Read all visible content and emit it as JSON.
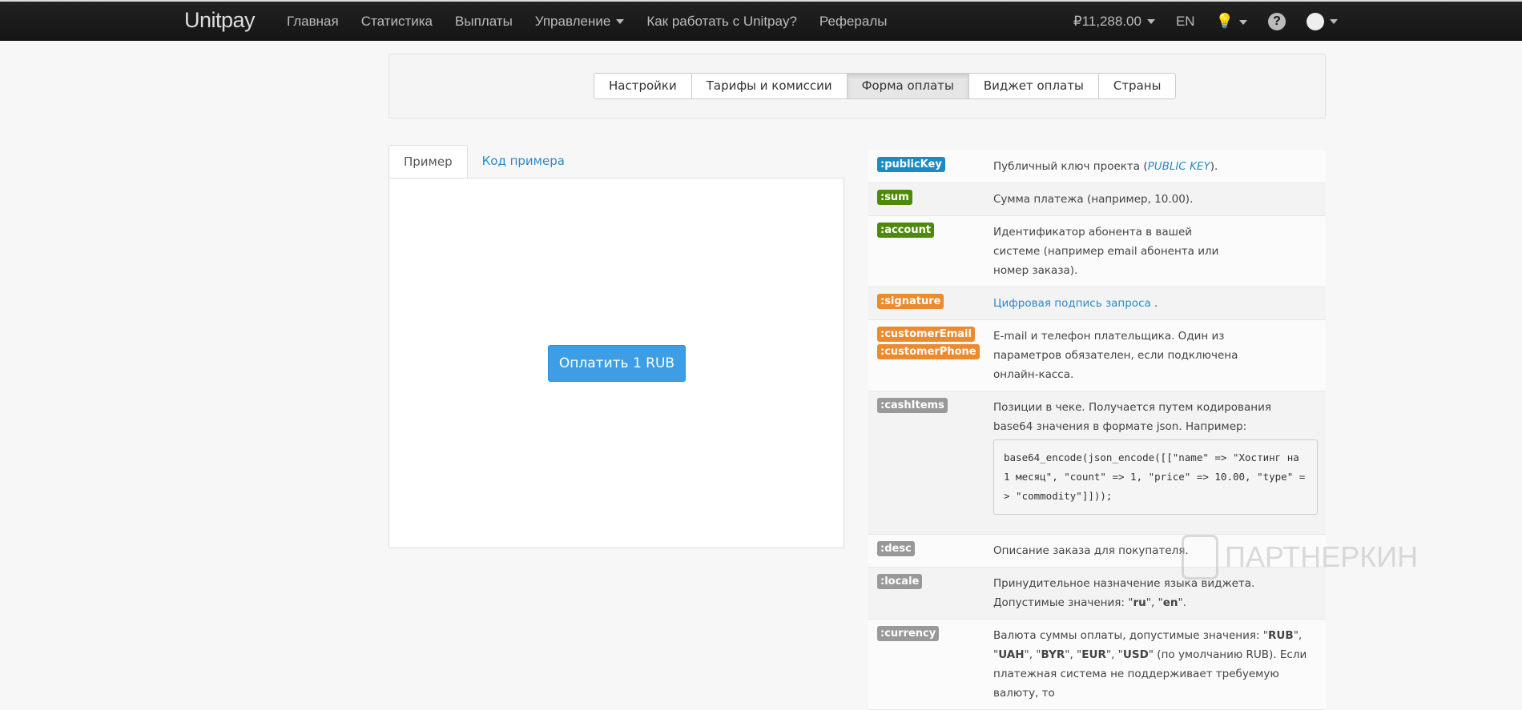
{
  "nav": {
    "logo": "Unitpay",
    "items": [
      "Главная",
      "Статистика",
      "Выплаты",
      "Управление",
      "Как работать с Unitpay?",
      "Рефералы"
    ],
    "balance": "₽11,288.00",
    "lang": "EN"
  },
  "settings_tabs": [
    {
      "label": "Настройки"
    },
    {
      "label": "Тарифы и комиссии"
    },
    {
      "label": "Форма оплаты",
      "active": true
    },
    {
      "label": "Виджет оплаты"
    },
    {
      "label": "Страны"
    }
  ],
  "example": {
    "tabs": [
      "Пример",
      "Код примера"
    ],
    "pay_button": "Оплатить 1 RUB"
  },
  "params": [
    {
      "name": ":publicKey",
      "color": "blue",
      "d1": "Публичный ключ проекта (",
      "link": "PUBLIC KEY",
      "d2": ")."
    },
    {
      "name": ":sum",
      "color": "green",
      "desc": "Сумма платежа (например, 10.00)."
    },
    {
      "name": ":account",
      "color": "green",
      "desc": "Идентификатор абонента в вашей системе (например email абонента или номер заказа)."
    },
    {
      "name": ":signature",
      "color": "orange",
      "link": "Цифровая подпись запроса",
      "d2": " ."
    },
    {
      "name": ":customerEmail",
      "name2": ":customerPhone",
      "color": "orange",
      "desc": "E-mail и телефон плательщика. Один из параметров обязателен, если подключена онлайн-касса."
    },
    {
      "name": ":cashItems",
      "color": "gray",
      "desc": "Позиции в чеке. Получается путем кодирования base64 значения в формате json. Например:",
      "code": "base64_encode(json_encode([[\"name\" => \"Хостинг на 1 месяц\", \"count\" => 1, \"price\" => 10.00, \"type\" => \"commodity\"]]));"
    },
    {
      "name": ":desc",
      "color": "gray",
      "desc": "Описание заказа для покупателя."
    },
    {
      "name": ":locale",
      "color": "gray",
      "d1": "Принудительное назначение языка виджета. Допустимые значения: \"",
      "b1": "ru",
      "d2": "\", \"",
      "b2": "en",
      "d3": "\"."
    },
    {
      "name": ":currency",
      "color": "gray",
      "d1": "Валюта суммы оплаты, допустимые значения: \"",
      "b1": "RUB",
      "d2": "\", \"",
      "b2": "UAH",
      "d3": "\", \"",
      "b3": "BYR",
      "d4": "\", \"",
      "b4": "EUR",
      "d5": "\", \"",
      "b5": "USD",
      "d6": "\" (по умолчанию RUB). Если платежная система не поддерживает требуемую валюту, то"
    }
  ],
  "watermark": "ПАРТНЕРКИН"
}
